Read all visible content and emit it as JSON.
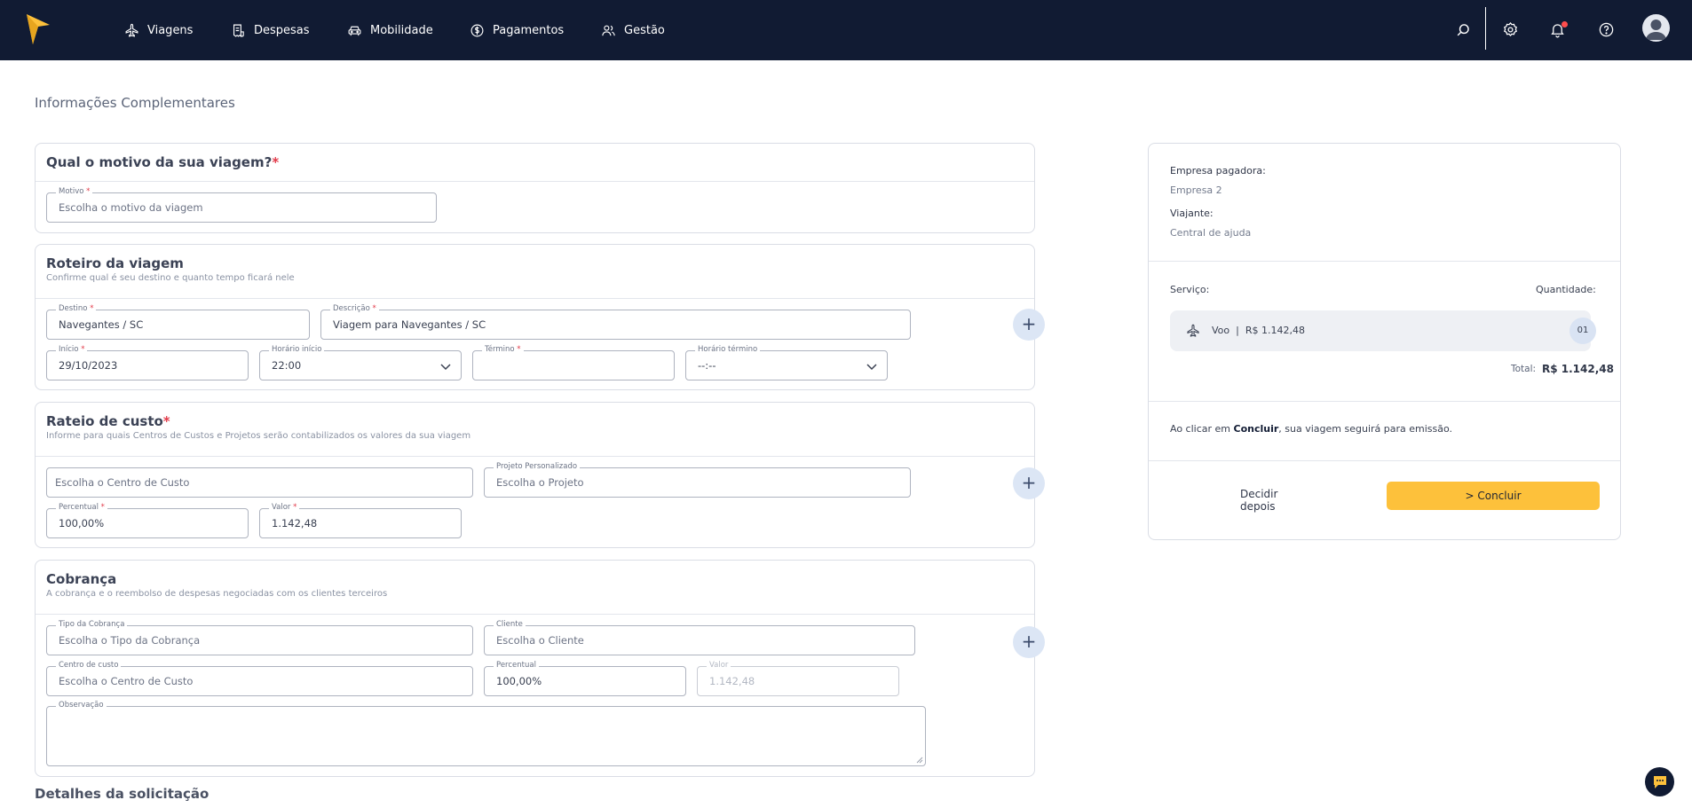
{
  "nav": {
    "items": [
      {
        "label": "Viagens",
        "icon": "plane-icon"
      },
      {
        "label": "Despesas",
        "icon": "receipt-icon"
      },
      {
        "label": "Mobilidade",
        "icon": "car-icon"
      },
      {
        "label": "Pagamentos",
        "icon": "dollar-circle-icon"
      },
      {
        "label": "Gestão",
        "icon": "users-icon"
      }
    ],
    "right_icons": [
      "search-icon",
      "gear-icon",
      "bell-icon",
      "help-icon",
      "avatar"
    ]
  },
  "page": {
    "title": "Informações Complementares"
  },
  "motivo": {
    "title": "Qual o motivo da sua viagem?",
    "required_mark": "*",
    "field_label": "Motivo",
    "field_placeholder": "Escolha o motivo da viagem"
  },
  "roteiro": {
    "title": "Roteiro da viagem",
    "subtitle": "Confirme qual é seu destino e quanto tempo ficará nele",
    "destino_label": "Destino",
    "destino_value": "Navegantes / SC",
    "descricao_label": "Descrição",
    "descricao_value": "Viagem para Navegantes / SC",
    "inicio_label": "Início",
    "inicio_value": "29/10/2023",
    "horario_inicio_label": "Horário início",
    "horario_inicio_value": "22:00",
    "termino_label": "Término",
    "termino_value": "",
    "horario_termino_label": "Horário término",
    "horario_termino_value": "--:--"
  },
  "rateio": {
    "title": "Rateio de custo",
    "required_mark": "*",
    "subtitle": "Informe para quais Centros de Custos e Projetos serão contabilizados os valores da sua viagem",
    "centro_placeholder": "Escolha o Centro de Custo",
    "projeto_label": "Projeto Personalizado",
    "projeto_placeholder": "Escolha o Projeto",
    "percentual_label": "Percentual",
    "percentual_value": "100,00%",
    "valor_label": "Valor",
    "valor_value": "1.142,48"
  },
  "cobranca": {
    "title": "Cobrança",
    "subtitle": "A cobrança e o reembolso de despesas negociadas com os clientes terceiros",
    "tipo_label": "Tipo da Cobrança",
    "tipo_placeholder": "Escolha o Tipo da Cobrança",
    "cliente_label": "Cliente",
    "cliente_placeholder": "Escolha o Cliente",
    "centro_label": "Centro de custo",
    "centro_placeholder": "Escolha o Centro de Custo",
    "percentual_label": "Percentual",
    "percentual_value": "100,00%",
    "valor_label": "Valor",
    "valor_value": "1.142,48",
    "observacao_label": "Observação"
  },
  "summary": {
    "empresa_label": "Empresa pagadora:",
    "empresa_value": "Empresa 2",
    "viajante_label": "Viajante:",
    "viajante_value": "Central de ajuda",
    "servico_label": "Serviço:",
    "quantidade_label": "Quantidade:",
    "service_text": "Voo  |  R$ 1.142,48",
    "service_qty": "01",
    "total_label": "Total:",
    "total_value": "R$ 1.142,48",
    "info_prefix": "Ao clicar em ",
    "info_bold": "Concluir",
    "info_suffix": ", sua viagem seguirá para emissão.",
    "later_label": "Decidir depois",
    "conclude_label": "> Concluir"
  },
  "footer": {
    "next_section_title": "Detalhes da solicitação"
  },
  "add_button_label": "+",
  "colors": {
    "navbar": "#111b33",
    "accent": "#fdc13b",
    "required": "#e23b4a"
  }
}
